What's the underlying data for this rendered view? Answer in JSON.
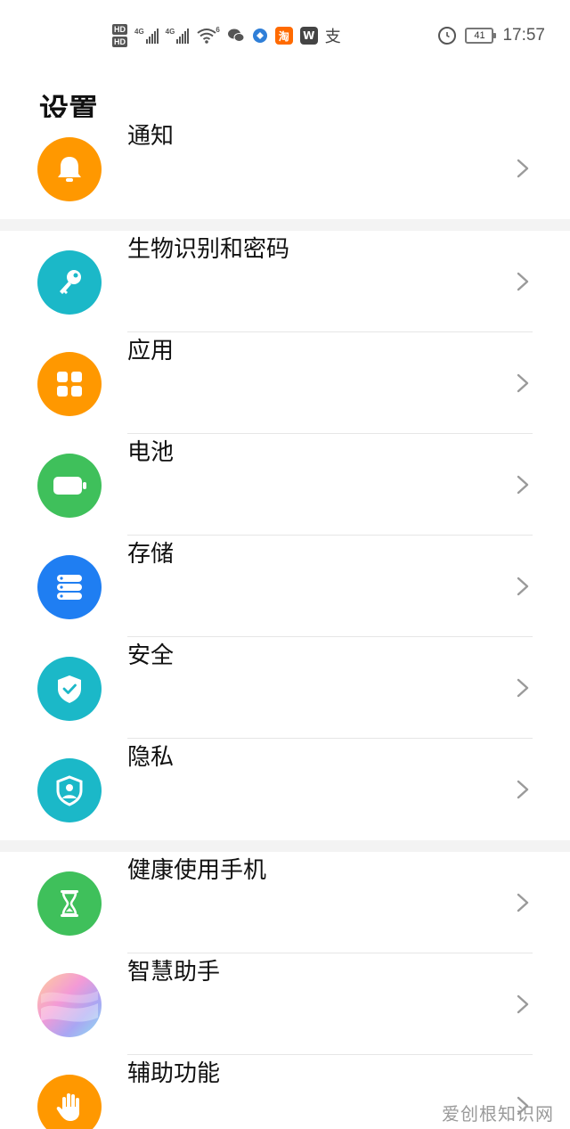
{
  "status_bar": {
    "hd1": "HD",
    "hd2": "HD",
    "net1": "4G",
    "net2": "4G",
    "wifi": "6",
    "app_taobao": "淘",
    "app_w": "W",
    "app_zhi": "支",
    "battery": "41",
    "time": "17:57"
  },
  "header": {
    "title": "设置"
  },
  "groups": [
    {
      "items": [
        {
          "label": "通知",
          "icon": "bell-icon",
          "color": "#ff9800"
        }
      ]
    },
    {
      "items": [
        {
          "label": "生物识别和密码",
          "icon": "key-icon",
          "color": "#1bb8c8"
        },
        {
          "label": "应用",
          "icon": "apps-grid-icon",
          "color": "#ff9800"
        },
        {
          "label": "电池",
          "icon": "battery-icon",
          "color": "#3fc05b"
        },
        {
          "label": "存储",
          "icon": "storage-icon",
          "color": "#1f7ef2"
        },
        {
          "label": "安全",
          "icon": "shield-check-icon",
          "color": "#1bb8c8"
        },
        {
          "label": "隐私",
          "icon": "privacy-shield-icon",
          "color": "#1bb8c8"
        }
      ]
    },
    {
      "items": [
        {
          "label": "健康使用手机",
          "icon": "hourglass-icon",
          "color": "#3fc05b"
        },
        {
          "label": "智慧助手",
          "icon": "assistant-icon",
          "color": "#e7a8e0"
        },
        {
          "label": "辅助功能",
          "icon": "hand-icon",
          "color": "#ff9800"
        }
      ]
    }
  ],
  "watermark": "爱创根知识网"
}
